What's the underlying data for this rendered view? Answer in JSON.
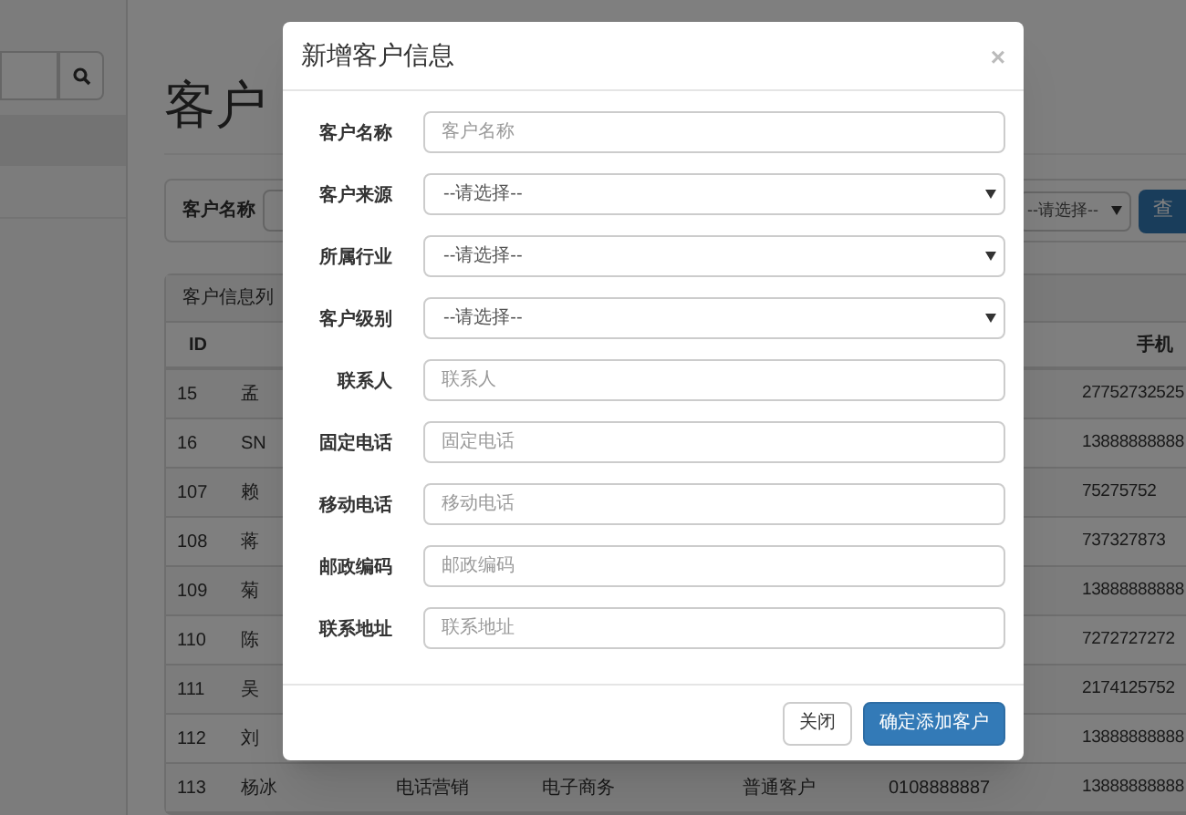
{
  "page": {
    "title": "客户"
  },
  "filter": {
    "label": "客户名称",
    "select_value": "--请选择--",
    "button": "查"
  },
  "table": {
    "heading": "客户信息列",
    "columns": {
      "id": "ID",
      "mobile": "手机"
    },
    "rows": [
      {
        "id": "15",
        "name": "孟",
        "mobile": "27752732525"
      },
      {
        "id": "16",
        "name": "SN",
        "mobile": "13888888888"
      },
      {
        "id": "107",
        "name": "赖",
        "mobile": "75275752"
      },
      {
        "id": "108",
        "name": "蒋",
        "mobile": "737327873"
      },
      {
        "id": "109",
        "name": "菊",
        "mobile": "13888888888"
      },
      {
        "id": "110",
        "name": "陈",
        "mobile": "7272727272"
      },
      {
        "id": "111",
        "name": "吴",
        "mobile": "2174125752"
      },
      {
        "id": "112",
        "name": "刘",
        "mobile": "13888888888"
      },
      {
        "id": "113",
        "name": "杨冰",
        "source": "电话营销",
        "industry": "电子商务",
        "level": "普通客户",
        "phone": "0108888887",
        "mobile": "13888888888"
      }
    ]
  },
  "modal": {
    "title": "新增客户信息",
    "close": "×",
    "fields": [
      {
        "label": "客户名称",
        "kind": "input",
        "placeholder": "客户名称"
      },
      {
        "label": "客户来源",
        "kind": "select",
        "value": "--请选择--"
      },
      {
        "label": "所属行业",
        "kind": "select",
        "value": "--请选择--"
      },
      {
        "label": "客户级别",
        "kind": "select",
        "value": "--请选择--"
      },
      {
        "label": "联系人",
        "kind": "input",
        "placeholder": "联系人"
      },
      {
        "label": "固定电话",
        "kind": "input",
        "placeholder": "固定电话"
      },
      {
        "label": "移动电话",
        "kind": "input",
        "placeholder": "移动电话"
      },
      {
        "label": "邮政编码",
        "kind": "input",
        "placeholder": "邮政编码"
      },
      {
        "label": "联系地址",
        "kind": "input",
        "placeholder": "联系地址"
      }
    ],
    "buttons": [
      {
        "label": "关闭",
        "kind": "default"
      },
      {
        "label": "确定添加客户",
        "kind": "primary"
      }
    ]
  }
}
